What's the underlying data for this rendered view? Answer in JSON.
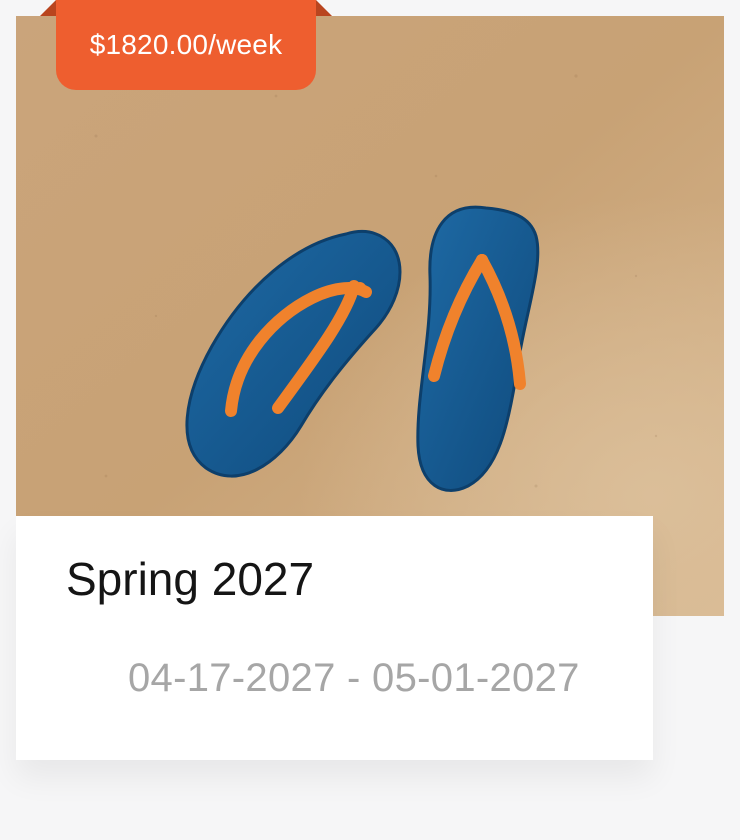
{
  "listing": {
    "price_label": "$1820.00/week",
    "title": "Spring 2027",
    "dates": "04-17-2027 - 05-01-2027",
    "image_subject": "blue flip-flops on sand"
  },
  "colors": {
    "accent": "#ee5e2f",
    "sand": "#c9a47a",
    "sandal_blue": "#1a5f96",
    "strap_orange": "#f0822c",
    "title_text": "#151515",
    "date_text": "#a6a6a6"
  }
}
